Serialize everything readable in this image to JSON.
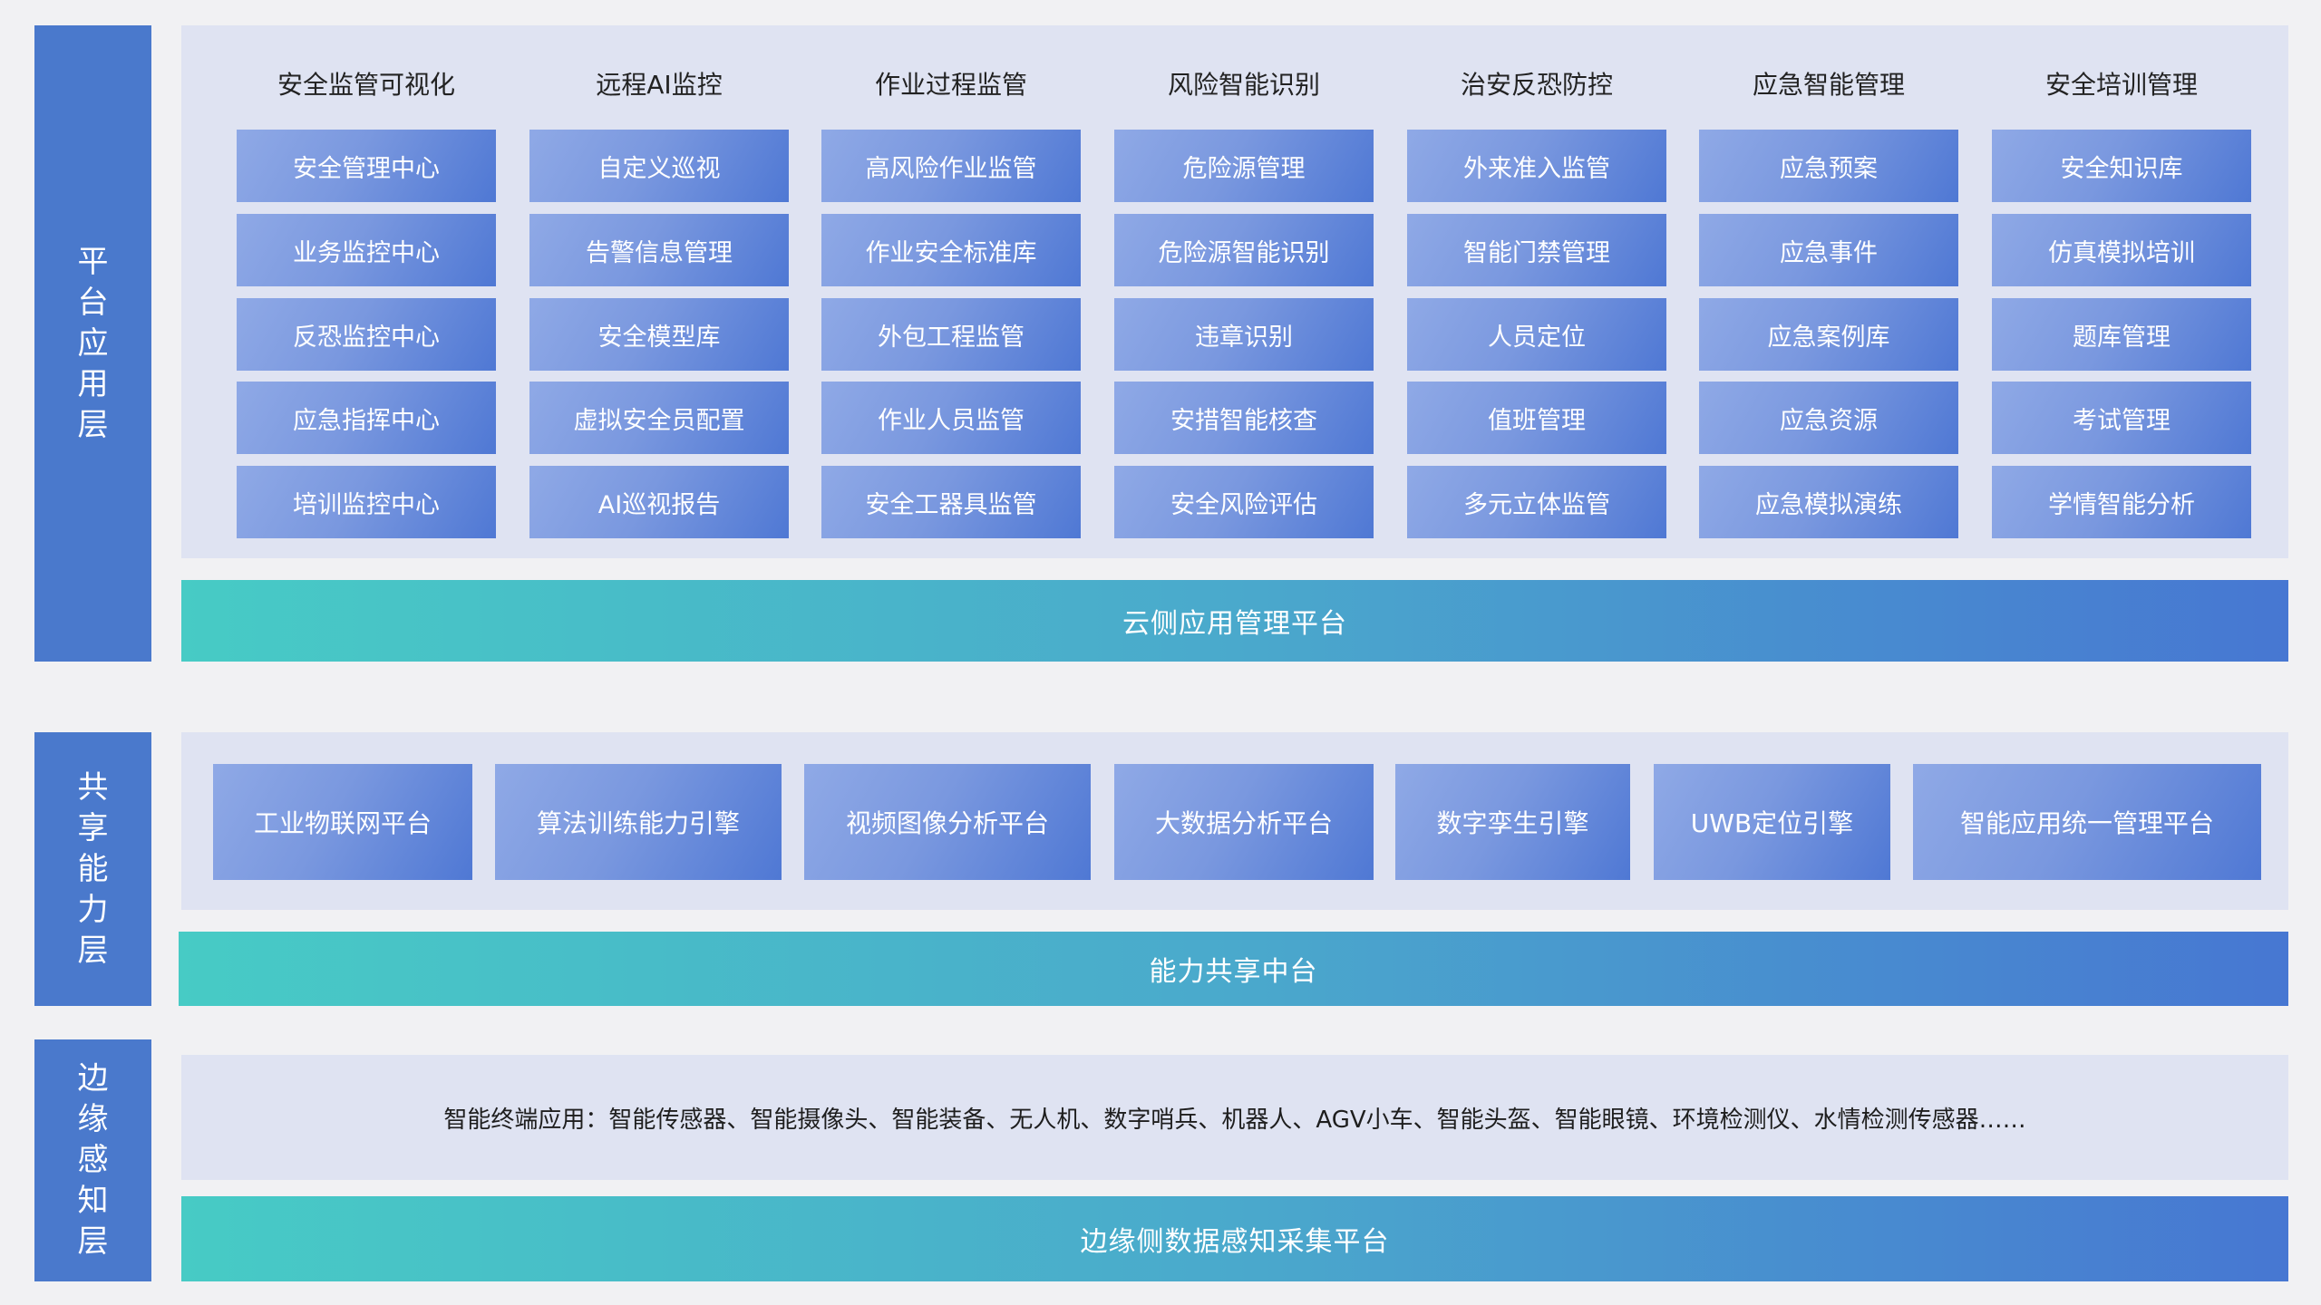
{
  "layers": {
    "platform": "平台应用层",
    "shared": "共享能力层",
    "edge": "边缘感知层"
  },
  "platform": {
    "columns": [
      {
        "title": "安全监管可视化",
        "items": [
          "安全管理中心",
          "业务监控中心",
          "反恐监控中心",
          "应急指挥中心",
          "培训监控中心"
        ]
      },
      {
        "title": "远程AI监控",
        "items": [
          "自定义巡视",
          "告警信息管理",
          "安全模型库",
          "虚拟安全员配置",
          "AI巡视报告"
        ]
      },
      {
        "title": "作业过程监管",
        "items": [
          "高风险作业监管",
          "作业安全标准库",
          "外包工程监管",
          "作业人员监管",
          "安全工器具监管"
        ]
      },
      {
        "title": "风险智能识别",
        "items": [
          "危险源管理",
          "危险源智能识别",
          "违章识别",
          "安措智能核查",
          "安全风险评估"
        ]
      },
      {
        "title": "治安反恐防控",
        "items": [
          "外来准入监管",
          "智能门禁管理",
          "人员定位",
          "值班管理",
          "多元立体监管"
        ]
      },
      {
        "title": "应急智能管理",
        "items": [
          "应急预案",
          "应急事件",
          "应急案例库",
          "应急资源",
          "应急模拟演练"
        ]
      },
      {
        "title": "安全培训管理",
        "items": [
          "安全知识库",
          "仿真模拟培训",
          "题库管理",
          "考试管理",
          "学情智能分析"
        ]
      }
    ],
    "band": "云侧应用管理平台"
  },
  "shared": {
    "items": [
      "工业物联网平台",
      "算法训练能力引擎",
      "视频图像分析平台",
      "大数据分析平台",
      "数字孪生引擎",
      "UWB定位引擎",
      "智能应用统一管理平台"
    ],
    "band": "能力共享中台"
  },
  "edge": {
    "text": "智能终端应用：智能传感器、智能摄像头、智能装备、无人机、数字哨兵、机器人、AGV小车、智能头盔、智能眼镜、环境检测仪、水情检测传感器……",
    "band": "边缘侧数据感知采集平台"
  }
}
